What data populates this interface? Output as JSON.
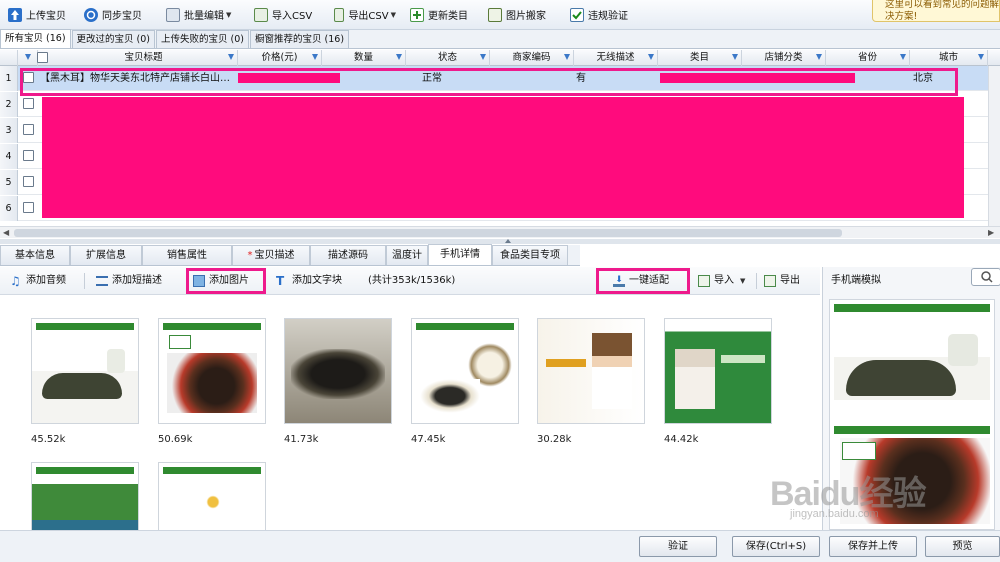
{
  "toolbar": {
    "buttons": [
      {
        "label": "上传宝贝",
        "icon": "upload-icon"
      },
      {
        "label": "同步宝贝",
        "icon": "sync-icon"
      },
      {
        "label": "批量编辑",
        "icon": "batch-edit-icon"
      },
      {
        "label": "导入CSV",
        "icon": "import-csv-icon"
      },
      {
        "label": "导出CSV",
        "icon": "export-csv-icon"
      },
      {
        "label": "更新类目",
        "icon": "update-category-icon"
      },
      {
        "label": "图片搬家",
        "icon": "image-move-icon"
      },
      {
        "label": "违规验证",
        "icon": "verify-icon"
      }
    ],
    "tooltip": "这里可以看到常见的问题解决方案!"
  },
  "top_tabs": [
    "所有宝贝 (16)",
    "更改过的宝贝 (0)",
    "上传失败的宝贝 (0)",
    "橱窗推荐的宝贝 (16)"
  ],
  "grid": {
    "headers": [
      "宝贝标题",
      "价格(元)",
      "数量",
      "状态",
      "商家编码",
      "无线描述",
      "类目",
      "店铺分类",
      "省份",
      "城市"
    ],
    "rows": [
      {
        "num": "1",
        "title": "【黑木耳】物华天美东北特产店铺长白山…",
        "status": "正常",
        "wireless": "有",
        "city": "北京"
      },
      {
        "num": "2"
      },
      {
        "num": "3"
      },
      {
        "num": "4"
      },
      {
        "num": "5"
      },
      {
        "num": "6"
      }
    ]
  },
  "bottom_tabs": [
    "基本信息",
    "扩展信息",
    "销售属性",
    "宝贝描述",
    "描述源码",
    "温度计",
    "手机详情",
    "食品类目专项"
  ],
  "subbar": {
    "add_audio": "添加音频",
    "add_short_desc": "添加短描述",
    "add_image": "添加图片",
    "add_text": "添加文字块",
    "total": "(共计353k/1536k)",
    "one_click": "一键适配",
    "import": "导入",
    "export": "导出"
  },
  "images": [
    {
      "size": "45.52k",
      "theme": "green-tea"
    },
    {
      "size": "50.69k",
      "theme": "fungus-red"
    },
    {
      "size": "41.73k",
      "theme": "dark-fungus"
    },
    {
      "size": "47.45k",
      "theme": "dish"
    },
    {
      "size": "30.28k",
      "theme": "woman"
    },
    {
      "size": "44.42k",
      "theme": "family"
    },
    {
      "size": "",
      "theme": "landscape"
    },
    {
      "size": "",
      "theme": "certificate"
    }
  ],
  "preview": {
    "title": "手机端模拟"
  },
  "footer": {
    "verify": "验证",
    "save": "保存(Ctrl+S)",
    "save_upload": "保存并上传",
    "preview": "预览"
  },
  "watermark": {
    "text": "Baidu经验",
    "sub": "jingyan.baidu.com"
  },
  "colors": {
    "highlight": "#ee1a8c",
    "redaction": "#ff0b7d",
    "selection": "#c8dcf5"
  }
}
